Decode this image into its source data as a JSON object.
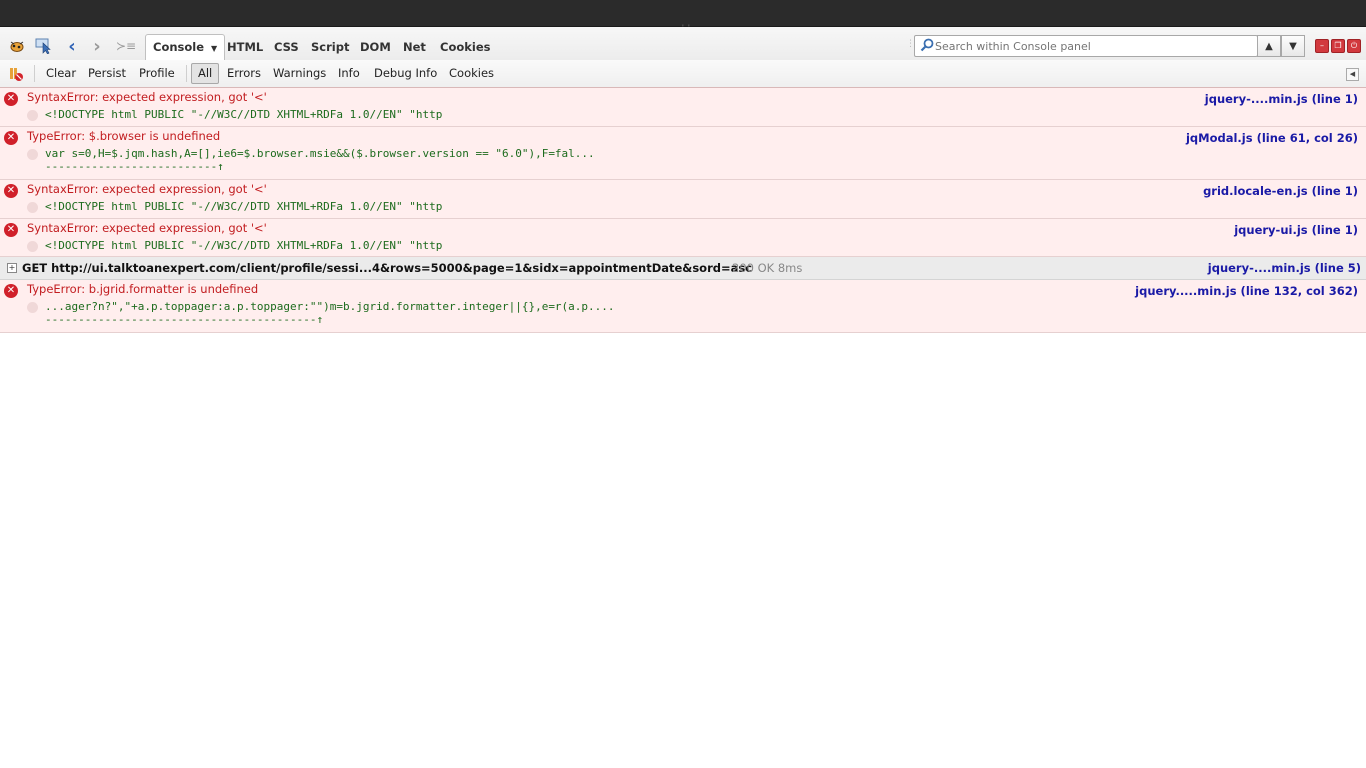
{
  "toolbar": {
    "icons": [
      "firebug-icon",
      "inspect-icon",
      "back-icon",
      "forward-icon",
      "command-line-icon"
    ],
    "tabs": [
      {
        "label": "Console",
        "active": true,
        "has_dropdown": true
      },
      {
        "label": "HTML"
      },
      {
        "label": "CSS"
      },
      {
        "label": "Script"
      },
      {
        "label": "DOM"
      },
      {
        "label": "Net"
      },
      {
        "label": "Cookies"
      }
    ],
    "search_placeholder": "Search within Console panel",
    "search_value": ""
  },
  "console_toolbar": {
    "actions": [
      "Clear",
      "Persist",
      "Profile"
    ],
    "filters": [
      {
        "label": "All",
        "active": true
      },
      {
        "label": "Errors"
      },
      {
        "label": "Warnings"
      },
      {
        "label": "Info"
      },
      {
        "label": "Debug Info"
      },
      {
        "label": "Cookies"
      }
    ]
  },
  "logs": [
    {
      "type": "error",
      "message": "SyntaxError: expected expression, got '<'",
      "source": "jquery-....min.js (line 1)",
      "code": "<!DOCTYPE html PUBLIC \"-//W3C//DTD XHTML+RDFa 1.0//EN\" \"http",
      "caret": ""
    },
    {
      "type": "error",
      "message": "TypeError: $.browser is undefined",
      "source": "jqModal.js (line 61, col 26)",
      "code": "var s=0,H=$.jqm.hash,A=[],ie6=$.browser.msie&&($.browser.version == \"6.0\"),F=fal...",
      "caret": "--------------------------↑"
    },
    {
      "type": "error",
      "message": "SyntaxError: expected expression, got '<'",
      "source": "grid.locale-en.js (line 1)",
      "code": "<!DOCTYPE html PUBLIC \"-//W3C//DTD XHTML+RDFa 1.0//EN\" \"http",
      "caret": ""
    },
    {
      "type": "error",
      "message": "SyntaxError: expected expression, got '<'",
      "source": "jquery-ui.js (line 1)",
      "code": "<!DOCTYPE html PUBLIC \"-//W3C//DTD XHTML+RDFa 1.0//EN\" \"http",
      "caret": ""
    }
  ],
  "net_request": {
    "label": "GET http://ui.talktoanexpert.com/client/profile/sessi...4&rows=5000&page=1&sidx=appointmentDate&sord=asc",
    "status": "200 OK 8ms",
    "source": "jquery-....min.js (line 5)"
  },
  "last_log": {
    "type": "error",
    "message": "TypeError: b.jgrid.formatter is undefined",
    "source": "jquery.....min.js (line 132, col 362)",
    "code": "...ager?n?\",\"+a.p.toppager:a.p.toppager:\"\")m=b.jgrid.formatter.integer||{},e=r(a.p....",
    "caret": "-----------------------------------------↑"
  }
}
